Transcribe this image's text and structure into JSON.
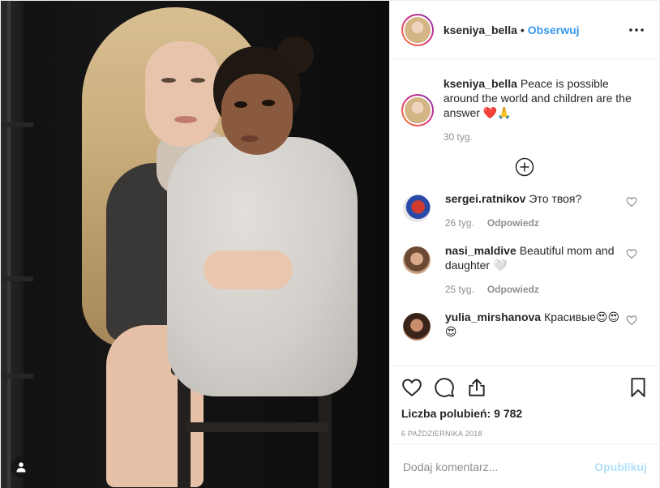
{
  "post": {
    "username": "kseniya_bella",
    "separator": "•",
    "follow_label": "Obserwuj",
    "caption_text": "Peace is possible around the world and children are the answer ❤️🙏",
    "caption_time": "30 tyg.",
    "likes": "Liczba polubień: 9 782",
    "date": "6 PAŹDZIERNIKA 2018"
  },
  "comments": [
    {
      "username": "sergei.ratnikov",
      "text": "Это твоя?",
      "time": "26 tyg.",
      "reply": "Odpowiedz"
    },
    {
      "username": "nasi_maldive",
      "text": "Beautiful mom and daughter 🤍",
      "time": "25 tyg.",
      "reply": "Odpowiedz"
    },
    {
      "username": "yulia_mirshanova",
      "text": "Красивые😍😍😍",
      "time": "",
      "reply": ""
    }
  ],
  "add_comment": {
    "placeholder": "Dodaj komentarz...",
    "publish_label": "Opublikuj"
  },
  "icons": {
    "more": "more-options-icon",
    "load_more": "plus-circle-icon",
    "like": "heart-icon",
    "comment": "comment-icon",
    "share": "share-icon",
    "save": "bookmark-icon",
    "user_tag": "user-tag-icon"
  },
  "colors": {
    "accent": "#3897f0",
    "publish_disabled": "#b2dffc",
    "muted": "#8e8e8e"
  }
}
